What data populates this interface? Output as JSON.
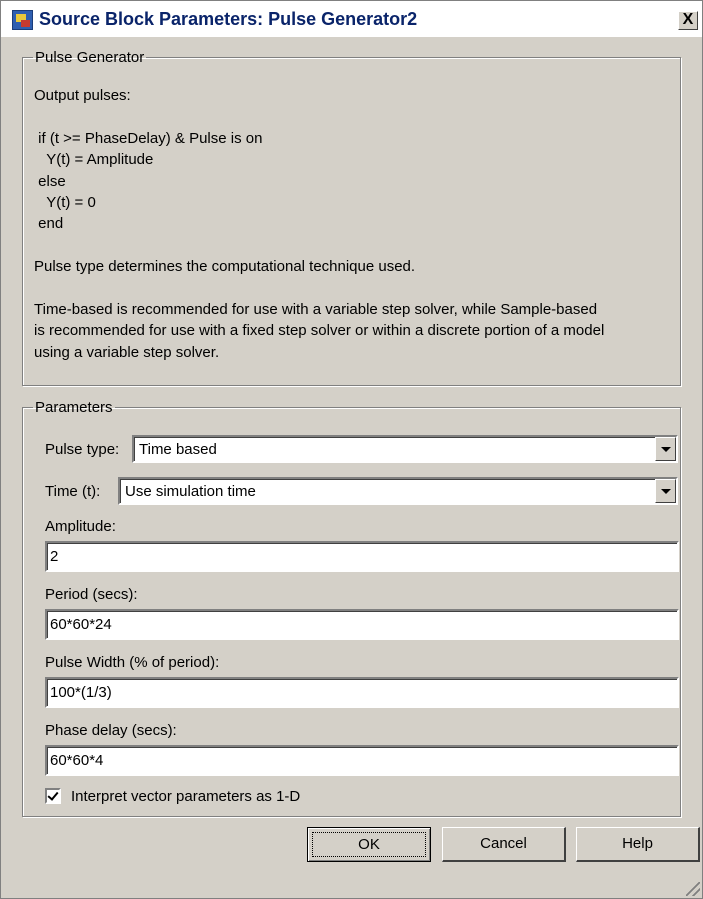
{
  "window": {
    "title": "Source Block Parameters: Pulse Generator2",
    "close_glyph": "X"
  },
  "description": {
    "group_title": "Pulse Generator",
    "text": "Output pulses:\n\n if (t >= PhaseDelay) & Pulse is on\n   Y(t) = Amplitude\n else\n   Y(t) = 0\n end\n\nPulse type determines the computational technique used.\n\nTime-based is recommended for use with a variable step solver, while Sample-based\nis recommended for use with a fixed step solver or within a discrete portion of a model\nusing a variable step solver."
  },
  "parameters": {
    "group_title": "Parameters",
    "pulse_type": {
      "label": "Pulse type:",
      "value": "Time based"
    },
    "time": {
      "label": "Time (t):",
      "value": "Use simulation time"
    },
    "amplitude": {
      "label": "Amplitude:",
      "value": "2"
    },
    "period": {
      "label": "Period (secs):",
      "value": "60*60*24"
    },
    "pulse_width": {
      "label": "Pulse Width (% of period):",
      "value": "100*(1/3)"
    },
    "phase_delay": {
      "label": "Phase delay (secs):",
      "value": "60*60*4"
    },
    "interpret_vector": {
      "label": "Interpret vector parameters as 1-D",
      "checked": true
    }
  },
  "buttons": {
    "ok": "OK",
    "cancel": "Cancel",
    "help": "Help"
  }
}
